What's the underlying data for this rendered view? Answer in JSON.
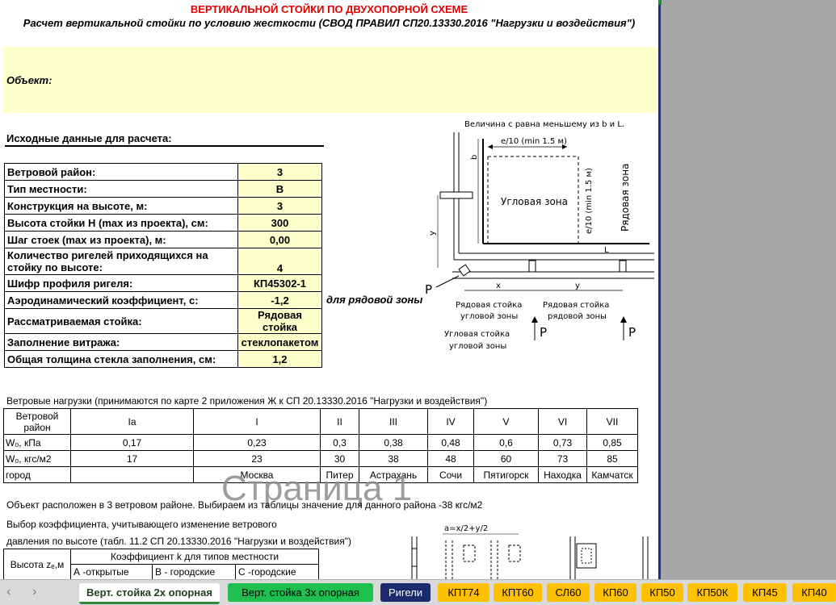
{
  "header": {
    "title": "ВЕРТИКАЛЬНОЙ СТОЙКИ ПО ДВУХОПОРНОЙ СХЕМЕ",
    "subtitle": "Расчет вертикальной стойки по условию жесткости (СВОД ПРАВИЛ СП20.13330.2016 \"Нагрузки и воздействия\")"
  },
  "object": {
    "label": "Объект:"
  },
  "input": {
    "title": "Исходные данные для расчета:",
    "rows": [
      {
        "label": "Ветровой район:",
        "value": "3"
      },
      {
        "label": "Тип местности:",
        "value": "В"
      },
      {
        "label": "Конструкция на высоте, м:",
        "value": "3"
      },
      {
        "label": "Высота стойки H (max из проекта), см:",
        "value": "300"
      },
      {
        "label": "Шаг стоек (max из проекта), м:",
        "value": "0,00"
      },
      {
        "label": "Количество ригелей приходящихся на стойку по высоте:",
        "value": "4"
      },
      {
        "label": "Шифр профиля ригеля:",
        "value": "КП45302-1"
      },
      {
        "label": "Аэродинамический коэффициент, c:",
        "value": "-1,2"
      },
      {
        "label": "Рассматриваемая стойка:",
        "value": "Рядовая стойка"
      },
      {
        "label": "Заполнение витража:",
        "value": "стеклопакетом"
      },
      {
        "label": "Общая толщина стекла заполнения, см:",
        "value": "1,2"
      }
    ],
    "zone_note": "для рядовой зоны"
  },
  "diagram": {
    "caption": "Величина с равна меньшему из b и L.",
    "e_top": "e/10 (min 1.5 м)",
    "e_side": "e/10 (min 1.5 м)",
    "corner_zone": "Угловая зона",
    "row_zone": "Рядовая зона",
    "b": "b",
    "y_left": "y",
    "L": "L",
    "x": "x",
    "y": "y",
    "P": "P",
    "lbl_row_corner_1": "Рядовая стойка",
    "lbl_row_corner_2": "угловой зоны",
    "lbl_row_row_1": "Рядовая стойка",
    "lbl_row_row_2": "рядовой зоны",
    "lbl_corner_1": "Угловая стойка",
    "lbl_corner_2": "угловой зоны"
  },
  "wind": {
    "caption": "Ветровые нагрузки (принимаются по карте 2  приложения Ж к СП 20.13330.2016 \"Нагрузки и воздействия\")",
    "header_label": "Ветровой район",
    "regions": [
      "Ia",
      "I",
      "II",
      "III",
      "IV",
      "V",
      "VI",
      "VII"
    ],
    "w0_kpa_label": "W₀, кПа",
    "w0_kpa": [
      "0,17",
      "0,23",
      "0,3",
      "0,38",
      "0,48",
      "0,6",
      "0,73",
      "0,85"
    ],
    "w0_kgs_label": "W₀, кгс/м2",
    "w0_kgs": [
      "17",
      "23",
      "30",
      "38",
      "48",
      "60",
      "73",
      "85"
    ],
    "city_label": "город",
    "cities": [
      "",
      "Москва",
      "Питер",
      "Астрахань",
      "Сочи",
      "Пятигорск",
      "Находка",
      "Камчатск"
    ]
  },
  "watermark": "Страница 1",
  "notes": {
    "n1": "Объект расположен в 3 ветровом районе. Выбираем из таблицы значение для данного района -38 кгс/м2",
    "n2": "Выбор коэффициента, учитывающего изменение ветрового",
    "n3": "давления по высоте (табл. 11.2  СП 20.13330.2016 \"Нагрузки и воздействия\")"
  },
  "coef": {
    "height_label": "Высота zₑ,м",
    "k_label": "Коэффициент k для типов местности",
    "types": [
      "А -открытые",
      "В - городские",
      "С -городские"
    ]
  },
  "mini_diagram": {
    "label": "a=x/2+y/2"
  },
  "tabs": [
    {
      "label": "Верт. стойка 2х опорная",
      "style": "active"
    },
    {
      "label": "Верт. стойка 3х опорная",
      "style": "green"
    },
    {
      "label": "Ригели",
      "style": "navy"
    },
    {
      "label": "КПТ74",
      "style": "yellow"
    },
    {
      "label": "КПТ60",
      "style": "yellow"
    },
    {
      "label": "СЛ60",
      "style": "yellow"
    },
    {
      "label": "КП60",
      "style": "yellow"
    },
    {
      "label": "КП50",
      "style": "yellow"
    },
    {
      "label": "КП50К",
      "style": "yellow"
    },
    {
      "label": "КП45",
      "style": "yellow"
    },
    {
      "label": "КП40",
      "style": "yellow"
    }
  ],
  "colors": {
    "title_red": "#e00000",
    "input_yellow": "#ffffcc",
    "tab_green": "#1fbf4f",
    "tab_navy": "#1a2a6c",
    "tab_yellow": "#ffc000"
  }
}
